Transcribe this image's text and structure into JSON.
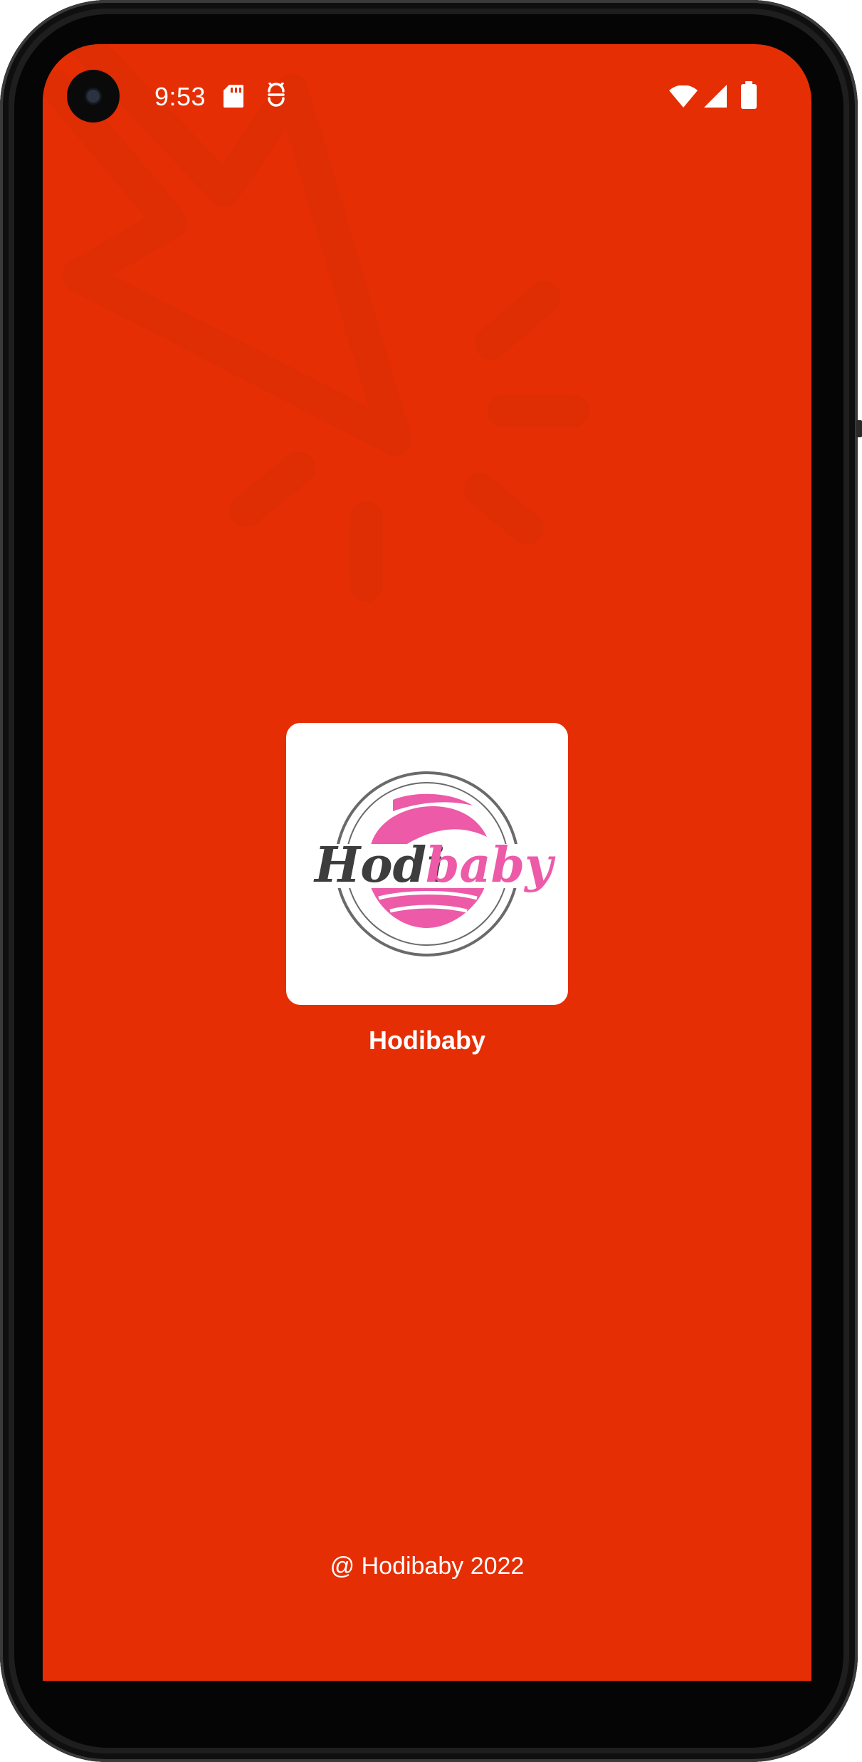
{
  "status_bar": {
    "time": "9:53",
    "icons": [
      "sd-card-icon",
      "assistant-icon",
      "wifi-icon",
      "cell-signal-icon",
      "battery-icon"
    ]
  },
  "splash": {
    "logo_text_dark": "Hodi",
    "logo_text_pink": "baby",
    "app_name": "Hodibaby",
    "copyright": "@ Hodibaby 2022"
  },
  "colors": {
    "background": "#e62e04",
    "logo_pink": "#ec5aa8",
    "logo_dark": "#3d3d3d"
  }
}
